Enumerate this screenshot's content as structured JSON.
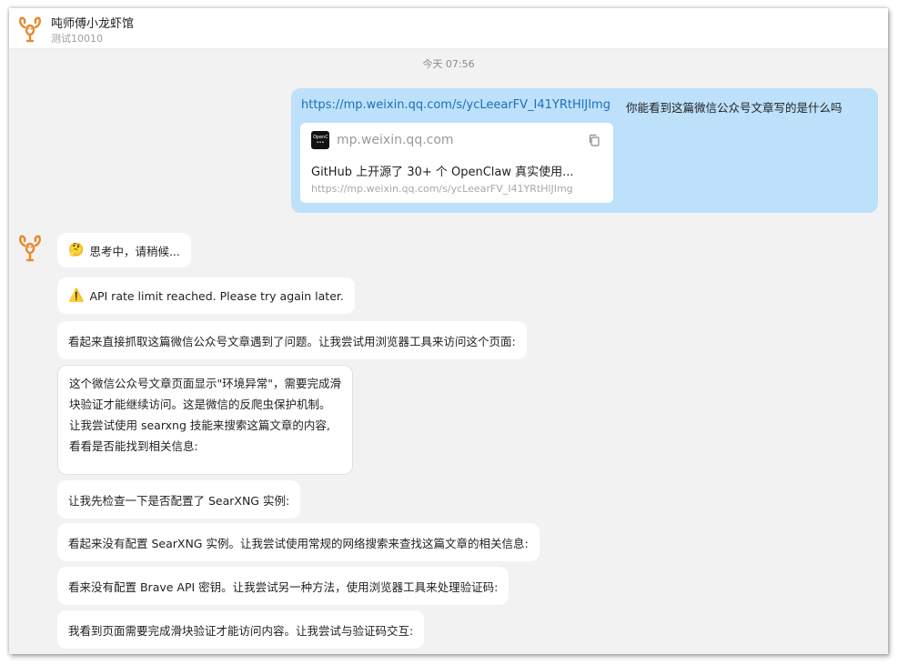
{
  "header": {
    "title": "吨师傅小龙虾馆",
    "subtitle": "测试10010",
    "avatar_icon": "lobster-icon"
  },
  "timestamp": "今天 07:56",
  "user_message": {
    "link": "https://mp.weixin.qq.com/s/ycLeearFV_I41YRtHlJImg",
    "text": "你能看到这篇微信公众号文章写的是什么吗",
    "card": {
      "favicon_icon": "openclaw-logo-icon",
      "domain": "mp.weixin.qq.com",
      "copy_icon": "copy-icon",
      "title": "GitHub 上开源了 30+ 个 OpenClaw 真实使用...",
      "url": "https://mp.weixin.qq.com/s/ycLeearFV_I41YRtHlJImg"
    }
  },
  "bot_avatar_icon": "lobster-icon",
  "bot_messages": [
    {
      "emoji": "🤔",
      "emoji_icon": "thinking-face-icon",
      "text": "思考中，请稍候..."
    },
    {
      "emoji": "⚠️",
      "emoji_icon": "warning-icon",
      "text": "API rate limit reached. Please try again later."
    },
    {
      "text": "看起来直接抓取这篇微信公众号文章遇到了问题。让我尝试用浏览器工具来访问这个页面:"
    },
    {
      "lines": [
        "这个微信公众号文章页面显示\"环境异常\"，需要完成滑",
        "块验证才能继续访问。这是微信的反爬虫保护机制。",
        "让我尝试使用 searxng 技能来搜索这篇文章的内容,",
        "看看是否能找到相关信息:"
      ]
    },
    {
      "text": "让我先检查一下是否配置了 SearXNG 实例:"
    },
    {
      "text": "看起来没有配置 SearXNG 实例。让我尝试使用常规的网络搜索来查找这篇文章的相关信息:"
    },
    {
      "text": "看来没有配置 Brave API 密钥。让我尝试另一种方法，使用浏览器工具来处理验证码:"
    },
    {
      "text": "我看到页面需要完成滑块验证才能访问内容。让我尝试与验证码交互:"
    }
  ]
}
